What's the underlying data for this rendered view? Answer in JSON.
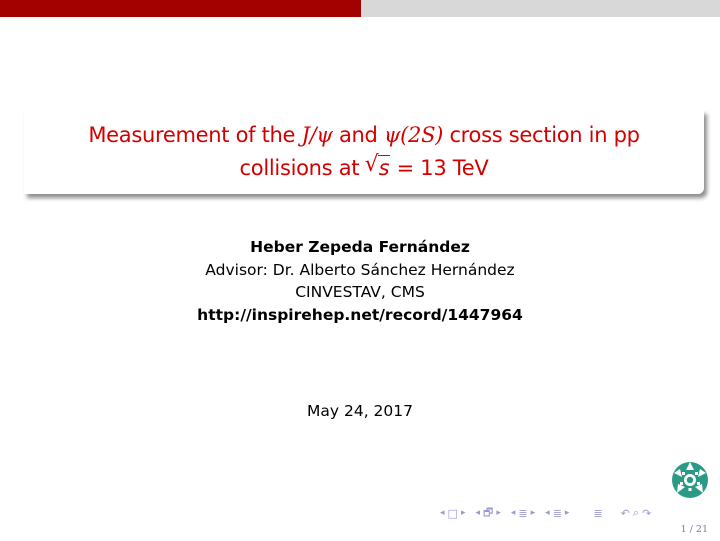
{
  "slide": {
    "title": {
      "line1_prefix": "Measurement of the ",
      "line1_math1": "J/ψ",
      "line1_and": " and ",
      "line1_math2": "ψ(2S)",
      "line1_suffix": " cross section in pp",
      "line2_prefix": "collisions at ",
      "line2_sqrt_symbol": "√",
      "line2_sqrt_arg": "s",
      "line2_suffix": " = 13 TeV"
    },
    "author": "Heber Zepeda Fernández",
    "advisor": "Advisor:  Dr.  Alberto Sánchez Hernández",
    "institute": "CINVESTAV, CMS",
    "url": "http://inspirehep.net/record/1447964",
    "date": "May 24, 2017"
  },
  "colors": {
    "header_left": "#a30000",
    "header_right": "#d8d8d8",
    "title_text": "#d40000",
    "logo": "#2a9a86",
    "nav": "#9a9ad0"
  },
  "navigation": {
    "frame_prev": "◂",
    "frame_icon": "□",
    "frame_next": "▸",
    "subsection_prev": "◂",
    "subsection_icon": "🗗",
    "subsection_next": "▸",
    "section_prev": "◂",
    "section_icon": "≣",
    "section_next": "▸",
    "subsect_prev": "◂",
    "subsect_icon": "≣",
    "subsect_next": "▸",
    "toc_icon": "≣",
    "back_icon": "↶",
    "search_icon": "⌕",
    "forward_icon": "↷"
  },
  "page": {
    "current": "1",
    "total": "21",
    "label": "1 / 21"
  }
}
